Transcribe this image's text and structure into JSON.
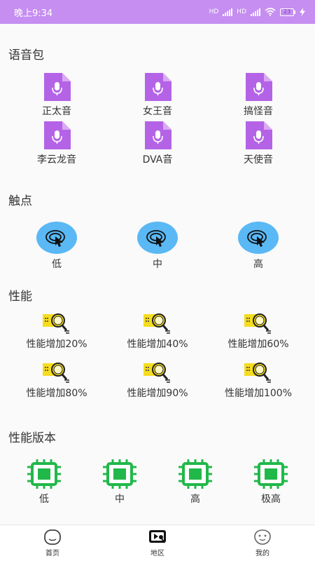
{
  "status": {
    "time": "晚上9:34",
    "hd": "HD",
    "battery": "23"
  },
  "voice": {
    "title": "语音包",
    "items": [
      {
        "label": "正太音"
      },
      {
        "label": "女王音"
      },
      {
        "label": "搞怪音"
      },
      {
        "label": "李云龙音"
      },
      {
        "label": "DVA音"
      },
      {
        "label": "天使音"
      }
    ]
  },
  "touch": {
    "title": "触点",
    "items": [
      {
        "label": "低"
      },
      {
        "label": "中"
      },
      {
        "label": "高"
      }
    ]
  },
  "perf": {
    "title": "性能",
    "items": [
      {
        "label": "性能增加20%"
      },
      {
        "label": "性能增加40%"
      },
      {
        "label": "性能增加60%"
      },
      {
        "label": "性能增加80%"
      },
      {
        "label": "性能增加90%"
      },
      {
        "label": "性能增加100%"
      }
    ]
  },
  "version": {
    "title": "性能版本",
    "items": [
      {
        "label": "低"
      },
      {
        "label": "中"
      },
      {
        "label": "高"
      },
      {
        "label": "极高"
      }
    ]
  },
  "tabs": [
    {
      "label": "首页",
      "icon": "face-icon"
    },
    {
      "label": "地区",
      "icon": "map-icon"
    },
    {
      "label": "我的",
      "icon": "smile-icon"
    }
  ],
  "colors": {
    "status_bar": "#c58ef0",
    "voice_icon": "#b463e6",
    "touch_icon": "#5ab8f5",
    "perf_icon": "#f5dc1f",
    "chip_icon": "#21b84a"
  }
}
